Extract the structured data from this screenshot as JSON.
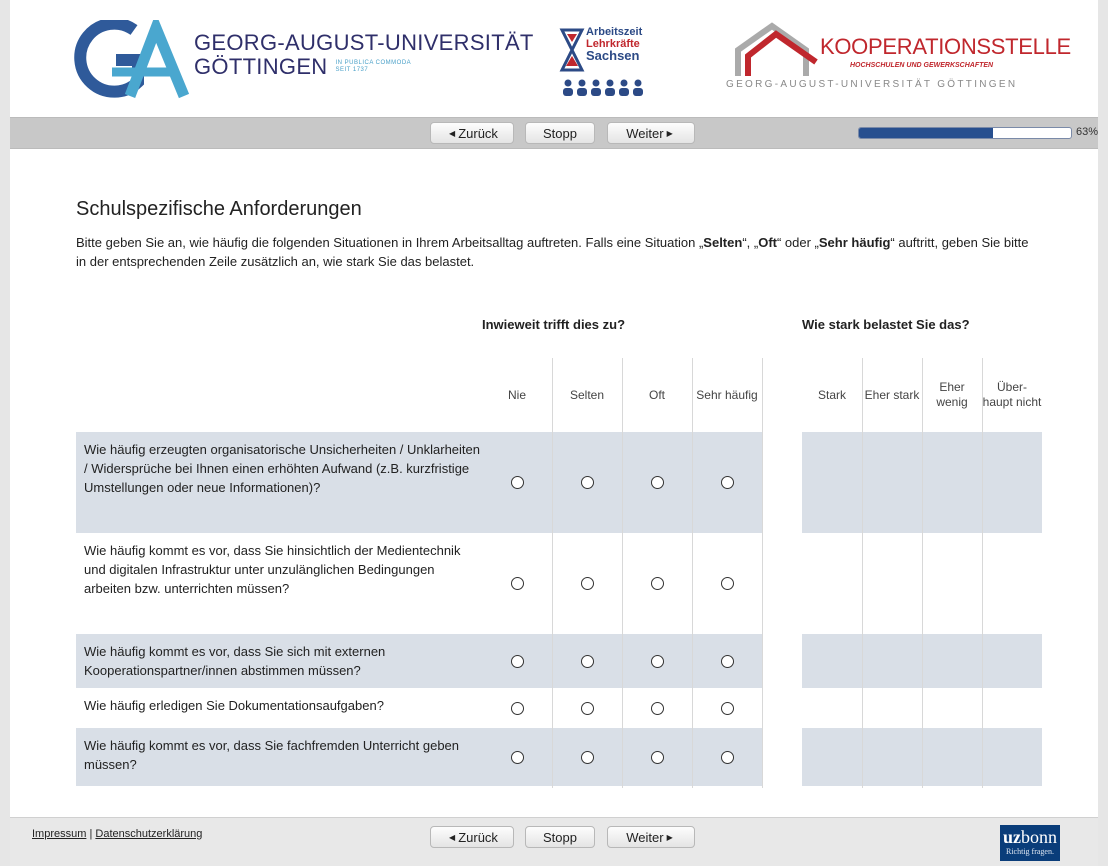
{
  "header": {
    "university_line1": "GEORG-AUGUST-UNIVERSITÄT",
    "university_line2": "GÖTTINGEN",
    "university_motto": "IN PUBLICA COMMODA",
    "university_since": "SEIT 1737",
    "lehrkraefte_line1": "Arbeitszeit",
    "lehrkraefte_line2": "Lehrkräfte",
    "lehrkraefte_line3": "Sachsen",
    "koop_title": "KOOPERATIONSSTELLE",
    "koop_subtitle": "HOCHSCHULEN UND GEWERKSCHAFTEN",
    "koop_university": "GEORG-AUGUST-UNIVERSITÄT GÖTTINGEN",
    "colors": {
      "brand_blue": "#2f2f6a",
      "brand_red": "#c0272d",
      "accent": "#274f8f"
    }
  },
  "nav": {
    "back_label": "Zurück",
    "stop_label": "Stopp",
    "next_label": "Weiter",
    "progress_percent": 63,
    "progress_label": "63%"
  },
  "page": {
    "title": "Schulspezifische Anforderungen",
    "intro_pre": "Bitte geben Sie an, wie häufig die folgenden Situationen in Ihrem Arbeitsalltag auftreten. Falls eine Situation „",
    "intro_b1": "Selten",
    "intro_m1": "“, „",
    "intro_b2": "Oft",
    "intro_m2": "“ oder „",
    "intro_b3": "Sehr häufig",
    "intro_post": "“ auftritt, geben Sie bitte in der entsprechenden Zeile zusätzlich an, wie stark Sie das belastet."
  },
  "table": {
    "group1_header": "Inwieweit trifft dies zu?",
    "group2_header": "Wie stark belastet Sie das?",
    "frequency_columns": [
      "Nie",
      "Selten",
      "Oft",
      "Sehr häufig"
    ],
    "strain_columns": [
      "Stark",
      "Eher stark",
      "Eher wenig",
      "Über-haupt nicht"
    ],
    "questions": [
      "Wie häufig erzeugten organisatorische Unsicherheiten / Unklarheiten / Widersprüche bei Ihnen einen erhöhten Aufwand (z.B. kurzfristige Umstellungen oder neue Informationen)?",
      "Wie häufig kommt es vor, dass Sie hinsichtlich der Medientechnik und digitalen Infrastruktur unter unzulänglichen Bedingungen arbeiten bzw. unterrichten müssen?",
      "Wie häufig kommt es vor, dass Sie sich mit externen Kooperationspartner/innen abstimmen müssen?",
      "Wie häufig erledigen Sie Dokumentationsaufgaben?",
      "Wie häufig kommt es vor, dass Sie fachfremden Unterricht geben müssen?"
    ]
  },
  "footer": {
    "impressum": "Impressum",
    "separator": "|",
    "datenschutz": "Datenschutzerklärung",
    "uzbonn_bold": "uz",
    "uzbonn_rest": "bonn",
    "uzbonn_tagline": "Richtig fragen."
  }
}
